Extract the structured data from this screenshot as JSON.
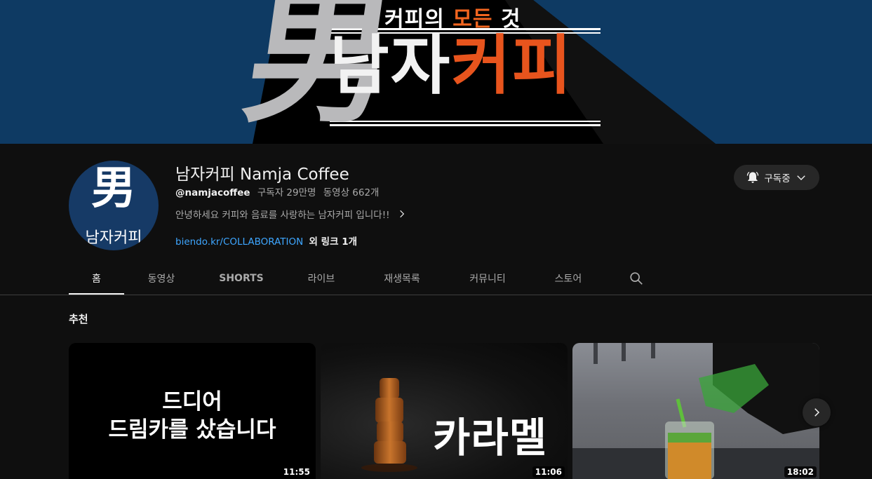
{
  "banner": {
    "subtitle_pre": "커피의 ",
    "subtitle_hl": "모든",
    "subtitle_post": " 것",
    "kanji": "男",
    "title_white": "남자",
    "title_orange": "커피"
  },
  "channel": {
    "avatar_kanji": "男",
    "avatar_name": "남자커피",
    "title": "남자커피 Namja Coffee",
    "handle": "@namjacoffee",
    "subscribers": "구독자 29만명",
    "videos": "동영상 662개",
    "description": "안녕하세요 커피와 음료를 사랑하는 남자커피 입니다!!",
    "link": "biendo.kr/COLLABORATION",
    "more_links": "외 링크 1개"
  },
  "subscribe": {
    "label": "구독중"
  },
  "tabs": [
    {
      "label": "홈"
    },
    {
      "label": "동영상"
    },
    {
      "label": "SHORTS"
    },
    {
      "label": "라이브"
    },
    {
      "label": "재생목록"
    },
    {
      "label": "커뮤니티"
    },
    {
      "label": "스토어"
    }
  ],
  "section": {
    "title": "추천"
  },
  "videos": [
    {
      "thumb_line1": "드디어",
      "thumb_line2": "드림카를 샀습니다",
      "duration": "11:55"
    },
    {
      "thumb_word": "카라멜",
      "duration": "11:06"
    },
    {
      "duration": "18:02"
    }
  ],
  "icons": {
    "bell": "bell-icon",
    "chevron": "chevron-down-icon",
    "search": "search-icon",
    "next": "chevron-right-icon"
  },
  "colors": {
    "banner_bg": "#0e3a63",
    "accent_orange": "#e8541d",
    "link_blue": "#3ea6ff",
    "page_bg": "#0f0f0f"
  }
}
